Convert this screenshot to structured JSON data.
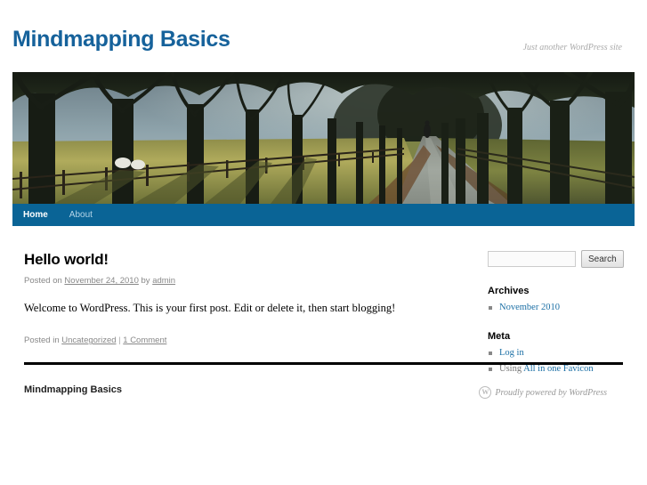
{
  "site": {
    "title": "Mindmapping Basics",
    "description": "Just another WordPress site"
  },
  "nav": {
    "items": [
      {
        "label": "Home",
        "current": true
      },
      {
        "label": "About",
        "current": false
      }
    ]
  },
  "post": {
    "title": "Hello world!",
    "meta_prefix": "Posted on ",
    "date": "November 24, 2010",
    "meta_by": " by ",
    "author": "admin",
    "content": "Welcome to WordPress. This is your first post. Edit or delete it, then start blogging!",
    "utility_prefix": "Posted in ",
    "category": "Uncategorized",
    "utility_sep": " | ",
    "comments": "1 Comment"
  },
  "sidebar": {
    "search": {
      "value": "",
      "placeholder": "",
      "button_label": "Search"
    },
    "archives": {
      "title": "Archives",
      "items": [
        {
          "label": "November 2010"
        }
      ]
    },
    "meta": {
      "title": "Meta",
      "login_label": "Log in",
      "using_prefix": "Using ",
      "plugin_label": "All in one Favicon"
    }
  },
  "footer": {
    "site_title": "Mindmapping Basics",
    "credit": "Proudly powered by WordPress",
    "wp_mark": "W"
  },
  "colors": {
    "link_blue": "#1b6fa5",
    "nav_blue": "#0a6496",
    "title_blue": "#16629b",
    "muted": "#888888"
  }
}
